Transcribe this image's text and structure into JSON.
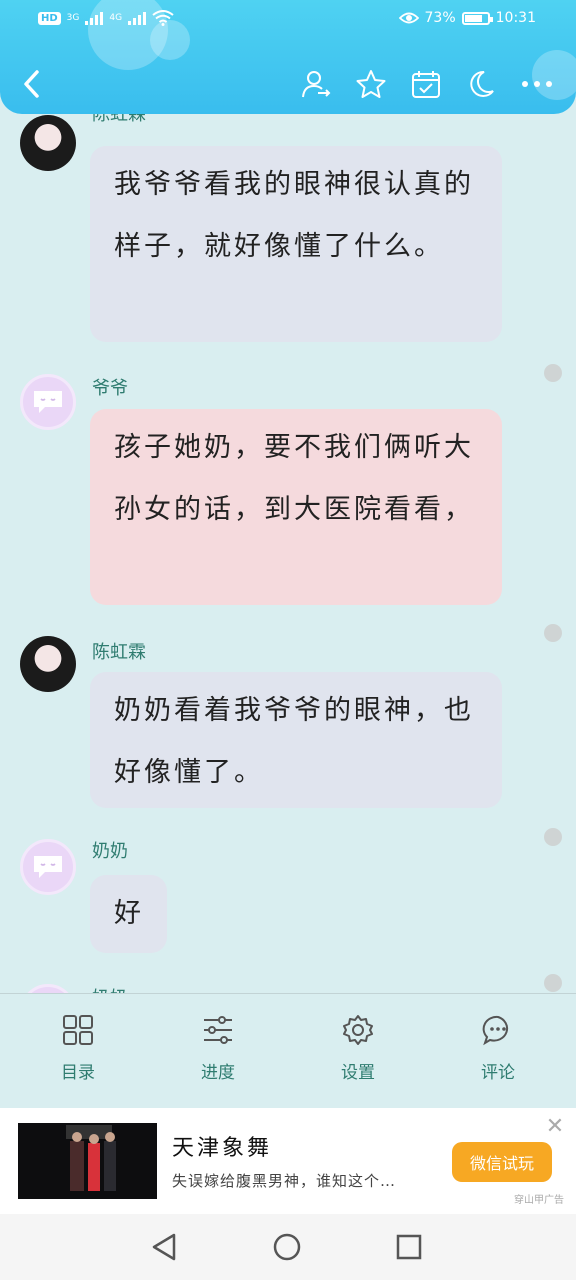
{
  "status_bar": {
    "hd_label": "HD",
    "sim1": "3G",
    "sim2": "4G",
    "battery_text": "73%",
    "battery_level": 0.73,
    "time": "10:31"
  },
  "header": {
    "back_icon": "chevron-left-icon",
    "actions": [
      "user-switch-icon",
      "star-icon",
      "calendar-check-icon",
      "moon-icon",
      "more-icon"
    ]
  },
  "messages": [
    {
      "name": "陈虹霖",
      "avatar": "photo",
      "style": "grey",
      "text": "我爷爷看我的眼神很认真的样子，就好像懂了什么。"
    },
    {
      "name": "爷爷",
      "avatar": "chat",
      "style": "pink",
      "text": "孩子她奶，要不我们俩听大孙女的话，到大医院看看，"
    },
    {
      "name": "陈虹霖",
      "avatar": "photo",
      "style": "grey",
      "text": "奶奶看着我爷爷的眼神，也好像懂了。"
    },
    {
      "name": "奶奶",
      "avatar": "chat",
      "style": "grey",
      "text": "好"
    },
    {
      "name": "奶奶",
      "avatar": "chat",
      "style": "grey",
      "text": ""
    }
  ],
  "bottom_nav": [
    {
      "label": "目录",
      "icon": "grid-icon"
    },
    {
      "label": "进度",
      "icon": "sliders-icon"
    },
    {
      "label": "设置",
      "icon": "gear-icon"
    },
    {
      "label": "评论",
      "icon": "comment-icon"
    }
  ],
  "ad": {
    "title": "天津象舞",
    "description": "失误嫁给腹黑男神，谁知这个…",
    "cta": "微信试玩",
    "source": "穿山甲广告"
  },
  "colors": {
    "header": "#39bdee",
    "page_bg": "#d9eef0",
    "accent_text": "#2f7c70",
    "bubble_grey": "#e0e4ee",
    "bubble_pink": "#f5dadd",
    "cta": "#f7a823"
  }
}
